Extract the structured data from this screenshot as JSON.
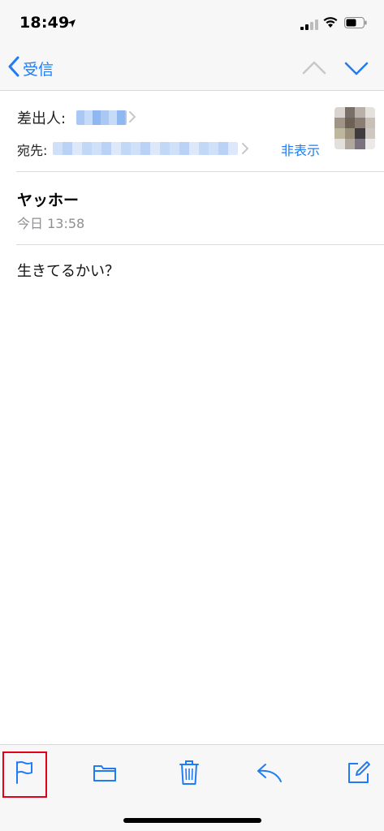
{
  "status_bar": {
    "time": "18:49",
    "icons": [
      "location-arrow-icon",
      "signal-icon",
      "wifi-icon",
      "battery-icon"
    ]
  },
  "nav": {
    "back_label": "受信",
    "icons": [
      "chevron-left-icon",
      "chevron-up-icon",
      "chevron-down-icon"
    ]
  },
  "header": {
    "from_label": "差出人:",
    "to_label": "宛先:",
    "hide_label": "非表示"
  },
  "message": {
    "subject": "ヤッホー",
    "date": "今日 13:58",
    "body": "生きてるかい？"
  },
  "toolbar": {
    "icons": [
      "flag-icon",
      "folder-icon",
      "trash-icon",
      "reply-icon",
      "compose-icon"
    ]
  },
  "colors": {
    "accent": "#1f7cf4",
    "highlight": "#e3001b",
    "secondary_text": "#8e8e93"
  }
}
